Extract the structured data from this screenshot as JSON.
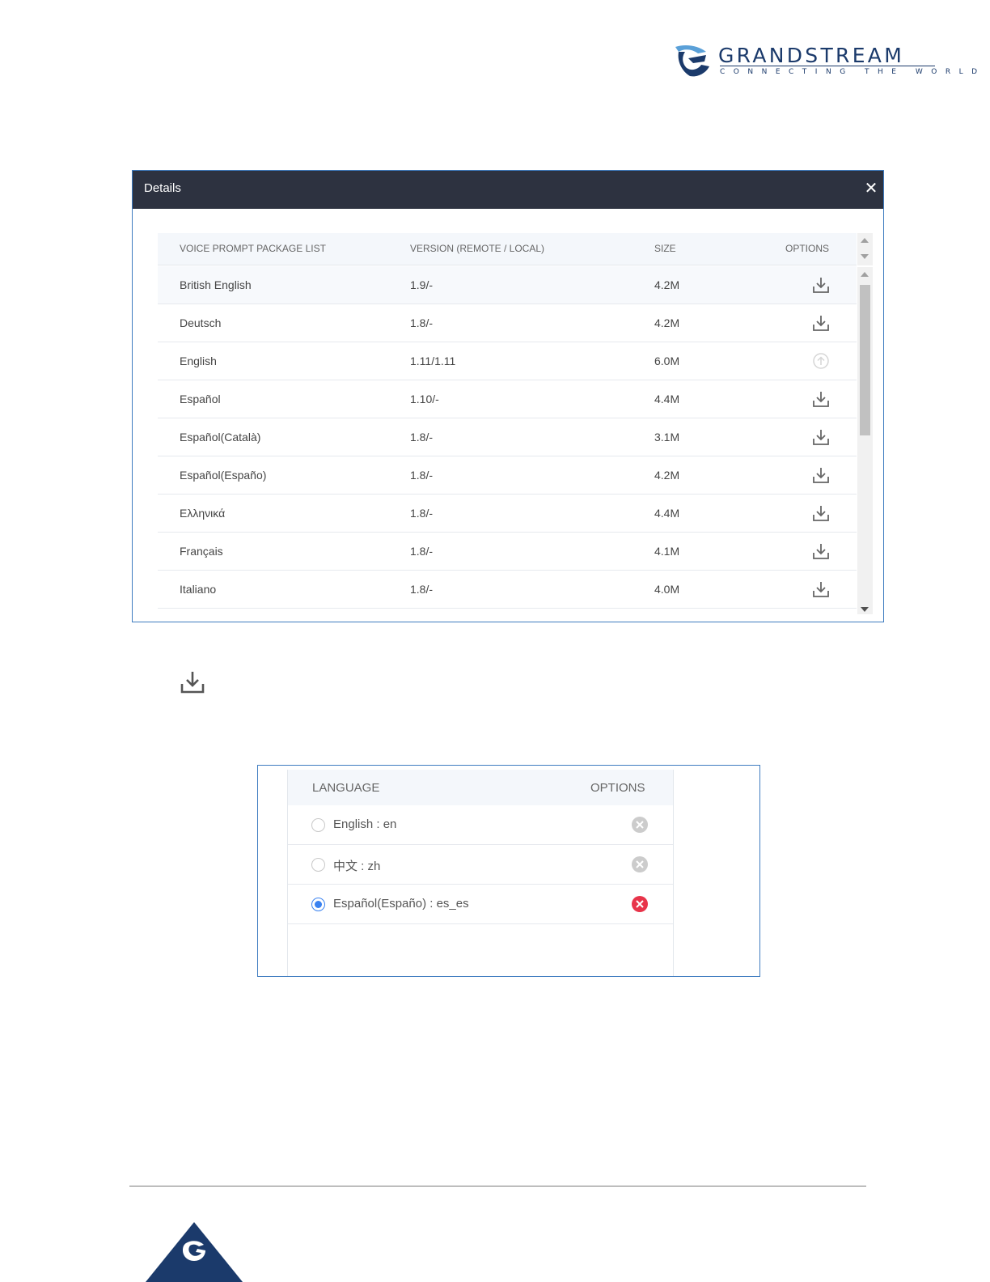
{
  "brand": {
    "name": "GRANDSTREAM",
    "tagline": "CONNECTING THE WORLD",
    "color": "#1b3a6b"
  },
  "dialog": {
    "title": "Details",
    "close_icon": "close-icon",
    "header_color": "#2d3240",
    "columns": [
      "VOICE PROMPT PACKAGE LIST",
      "VERSION (REMOTE / LOCAL)",
      "SIZE",
      "OPTIONS"
    ],
    "rows": [
      {
        "name": "British English",
        "version": "1.9/-",
        "size": "4.2M",
        "option": "download-icon"
      },
      {
        "name": "Deutsch",
        "version": "1.8/-",
        "size": "4.2M",
        "option": "download-icon"
      },
      {
        "name": "English",
        "version": "1.11/1.11",
        "size": "6.0M",
        "option": "upgrade-icon"
      },
      {
        "name": "Español",
        "version": "1.10/-",
        "size": "4.4M",
        "option": "download-icon"
      },
      {
        "name": "Español(Català)",
        "version": "1.8/-",
        "size": "3.1M",
        "option": "download-icon"
      },
      {
        "name": "Español(Españo)",
        "version": "1.8/-",
        "size": "4.2M",
        "option": "download-icon"
      },
      {
        "name": "Ελληνικά",
        "version": "1.8/-",
        "size": "4.4M",
        "option": "download-icon"
      },
      {
        "name": "Français",
        "version": "1.8/-",
        "size": "4.1M",
        "option": "download-icon"
      },
      {
        "name": "Italiano",
        "version": "1.8/-",
        "size": "4.0M",
        "option": "download-icon"
      }
    ]
  },
  "legend_icon": "download-icon",
  "languages": {
    "columns": [
      "LANGUAGE",
      "OPTIONS"
    ],
    "rows": [
      {
        "label": "English : en",
        "selected": false,
        "delete_color": "#cccccc"
      },
      {
        "label": "中文 : zh",
        "selected": false,
        "delete_color": "#cccccc"
      },
      {
        "label": "Español(Españo) : es_es",
        "selected": true,
        "delete_color": "#e8344a"
      }
    ],
    "accent": "#3a82f0"
  }
}
